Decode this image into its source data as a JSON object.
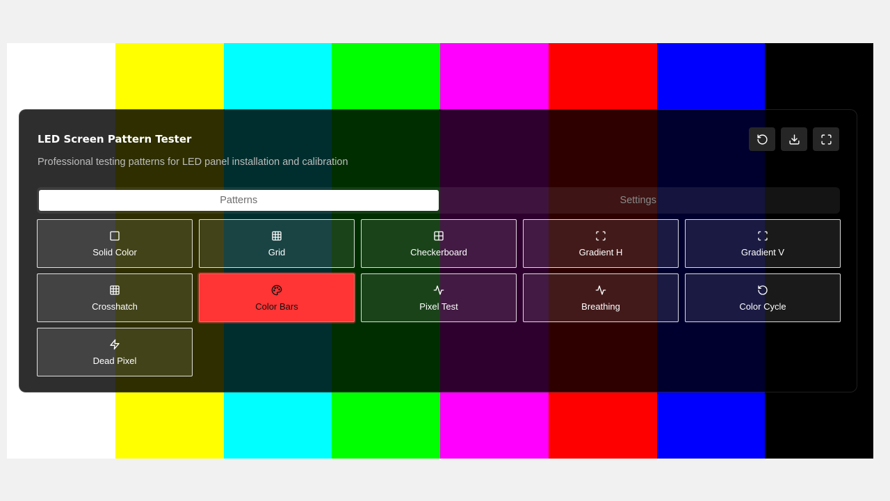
{
  "app": {
    "title": "LED Screen Pattern Tester",
    "subtitle": "Professional testing patterns for LED panel installation and calibration"
  },
  "actions": [
    {
      "icon": "reset-icon"
    },
    {
      "icon": "download-icon"
    },
    {
      "icon": "fullscreen-icon"
    }
  ],
  "tabs": [
    {
      "label": "Patterns",
      "active": true
    },
    {
      "label": "Settings",
      "active": false
    }
  ],
  "patterns": [
    {
      "label": "Solid Color",
      "icon": "square-icon"
    },
    {
      "label": "Grid",
      "icon": "grid-icon"
    },
    {
      "label": "Checkerboard",
      "icon": "checkerboard-icon"
    },
    {
      "label": "Gradient H",
      "icon": "scan-frame-icon"
    },
    {
      "label": "Gradient V",
      "icon": "scan-frame-icon"
    },
    {
      "label": "Crosshatch",
      "icon": "grid-icon"
    },
    {
      "label": "Color Bars",
      "icon": "palette-icon",
      "selected": true
    },
    {
      "label": "Pixel Test",
      "icon": "activity-icon"
    },
    {
      "label": "Breathing",
      "icon": "activity-icon"
    },
    {
      "label": "Color Cycle",
      "icon": "rotate-icon"
    },
    {
      "label": "Dead Pixel",
      "icon": "zap-icon"
    }
  ],
  "color_bars": [
    "#ffffff",
    "#ffff00",
    "#00ffff",
    "#00ff00",
    "#ff00ff",
    "#ff0000",
    "#0000ff",
    "#000000"
  ]
}
